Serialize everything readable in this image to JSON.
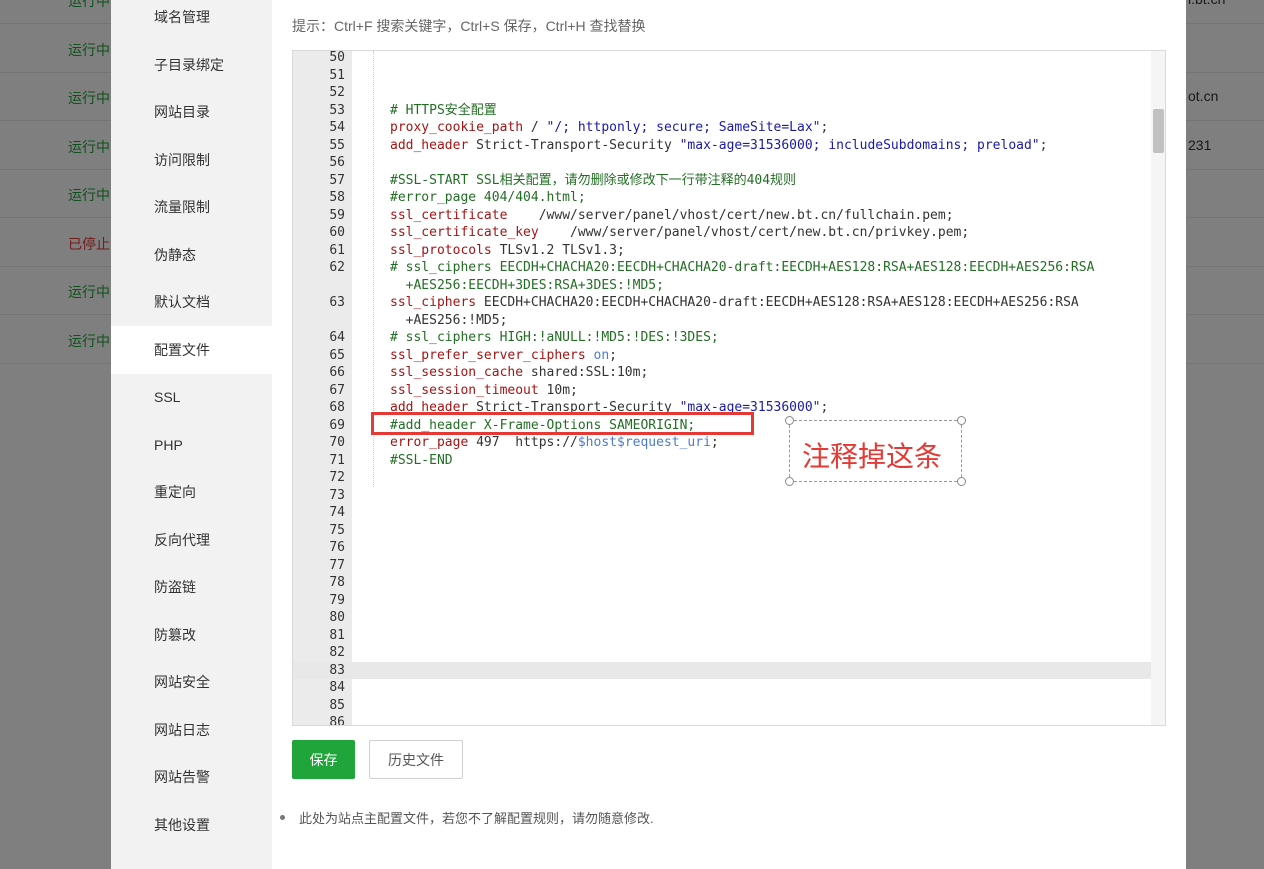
{
  "background": {
    "rows": [
      {
        "status": "运行中",
        "color": "#20a53a",
        "right": "i.bt.cn"
      },
      {
        "status": "运行中",
        "color": "#20a53a",
        "right": ""
      },
      {
        "status": "运行中",
        "color": "#20a53a",
        "right": "ot.cn"
      },
      {
        "status": "运行中",
        "color": "#20a53a",
        "right": "231"
      },
      {
        "status": "运行中",
        "color": "#20a53a",
        "right": ""
      },
      {
        "status": "已停止",
        "color": "#e53935",
        "right": ""
      },
      {
        "status": "运行中",
        "color": "#20a53a",
        "right": ""
      },
      {
        "status": "运行中",
        "color": "#20a53a",
        "right": ""
      }
    ]
  },
  "sidebar": {
    "items": [
      {
        "label": "域名管理"
      },
      {
        "label": "子目录绑定"
      },
      {
        "label": "网站目录"
      },
      {
        "label": "访问限制"
      },
      {
        "label": "流量限制"
      },
      {
        "label": "伪静态"
      },
      {
        "label": "默认文档"
      },
      {
        "label": "配置文件",
        "active": true
      },
      {
        "label": "SSL"
      },
      {
        "label": "PHP"
      },
      {
        "label": "重定向"
      },
      {
        "label": "反向代理"
      },
      {
        "label": "防盗链"
      },
      {
        "label": "防篡改"
      },
      {
        "label": "网站安全"
      },
      {
        "label": "网站日志"
      },
      {
        "label": "网站告警"
      },
      {
        "label": "其他设置"
      }
    ]
  },
  "editor": {
    "hint": "提示：Ctrl+F 搜索关键字，Ctrl+S 保存，Ctrl+H 查找替换",
    "highlight_line": "83",
    "lines": [
      {
        "n": "50",
        "parts": []
      },
      {
        "n": "51",
        "parts": []
      },
      {
        "n": "52",
        "parts": []
      },
      {
        "n": "53",
        "parts": [
          {
            "t": "# HTTPS安全配置",
            "c": "cmt"
          }
        ]
      },
      {
        "n": "54",
        "parts": [
          {
            "t": "proxy_cookie_path",
            "c": "key"
          },
          {
            "t": " / ",
            "c": "plain"
          },
          {
            "t": "\"/; httponly; secure; SameSite=Lax\"",
            "c": "str"
          },
          {
            "t": ";",
            "c": "plain"
          }
        ]
      },
      {
        "n": "55",
        "parts": [
          {
            "t": "add_header",
            "c": "key"
          },
          {
            "t": " Strict-Transport-Security ",
            "c": "plain"
          },
          {
            "t": "\"max-age=31536000; includeSubdomains; preload\"",
            "c": "str"
          },
          {
            "t": ";",
            "c": "plain"
          }
        ]
      },
      {
        "n": "56",
        "parts": []
      },
      {
        "n": "57",
        "parts": [
          {
            "t": "#SSL-START SSL相关配置，请勿删除或修改下一行带注释的404规则",
            "c": "cmt"
          }
        ]
      },
      {
        "n": "58",
        "parts": [
          {
            "t": "#error_page 404/404.html;",
            "c": "cmt"
          }
        ]
      },
      {
        "n": "59",
        "parts": [
          {
            "t": "ssl_certificate",
            "c": "key"
          },
          {
            "t": "    /www/server/panel/vhost/cert/new.bt.cn/fullchain.pem;",
            "c": "plain"
          }
        ]
      },
      {
        "n": "60",
        "parts": [
          {
            "t": "ssl_certificate_key",
            "c": "key"
          },
          {
            "t": "    /www/server/panel/vhost/cert/new.bt.cn/privkey.pem;",
            "c": "plain"
          }
        ]
      },
      {
        "n": "61",
        "parts": [
          {
            "t": "ssl_protocols",
            "c": "key"
          },
          {
            "t": " TLSv1.2 TLSv1.3;",
            "c": "plain"
          }
        ]
      },
      {
        "n": "62",
        "parts": [
          {
            "t": "# ssl_ciphers EECDH+CHACHA20:EECDH+CHACHA20-draft:EECDH+AES128:RSA+AES128:EECDH+AES256:RSA",
            "c": "cmt"
          }
        ]
      },
      {
        "n": "",
        "parts": [
          {
            "t": "  +AES256:EECDH+3DES:RSA+3DES:!MD5;",
            "c": "cmt"
          }
        ]
      },
      {
        "n": "63",
        "parts": [
          {
            "t": "ssl_ciphers",
            "c": "key"
          },
          {
            "t": " EECDH+CHACHA20:EECDH+CHACHA20-draft:EECDH+AES128:RSA+AES128:EECDH+AES256:RSA",
            "c": "plain"
          }
        ]
      },
      {
        "n": "",
        "parts": [
          {
            "t": "  +AES256:!MD5;",
            "c": "plain"
          }
        ]
      },
      {
        "n": "64",
        "parts": [
          {
            "t": "# ssl_ciphers HIGH:!aNULL:!MD5:!DES:!3DES;",
            "c": "cmt"
          }
        ]
      },
      {
        "n": "65",
        "parts": [
          {
            "t": "ssl_prefer_server_ciphers",
            "c": "key"
          },
          {
            "t": " ",
            "c": "plain"
          },
          {
            "t": "on",
            "c": "var"
          },
          {
            "t": ";",
            "c": "plain"
          }
        ]
      },
      {
        "n": "66",
        "parts": [
          {
            "t": "ssl_session_cache",
            "c": "key"
          },
          {
            "t": " shared:SSL:10m;",
            "c": "plain"
          }
        ]
      },
      {
        "n": "67",
        "parts": [
          {
            "t": "ssl_session_timeout",
            "c": "key"
          },
          {
            "t": " 10m;",
            "c": "plain"
          }
        ]
      },
      {
        "n": "68",
        "parts": [
          {
            "t": "add_header",
            "c": "key"
          },
          {
            "t": " Strict-Transport-Security ",
            "c": "plain"
          },
          {
            "t": "\"max-age=31536000\"",
            "c": "str"
          },
          {
            "t": ";",
            "c": "plain"
          }
        ]
      },
      {
        "n": "69",
        "parts": [
          {
            "t": "#add_header X-Frame-Options SAMEORIGIN;",
            "c": "cmt"
          }
        ]
      },
      {
        "n": "70",
        "parts": [
          {
            "t": "error_page",
            "c": "key"
          },
          {
            "t": " 497  https://",
            "c": "plain"
          },
          {
            "t": "$host$request_uri",
            "c": "var"
          },
          {
            "t": ";",
            "c": "plain"
          }
        ]
      },
      {
        "n": "71",
        "parts": [
          {
            "t": "#SSL-END",
            "c": "cmt"
          }
        ]
      },
      {
        "n": "72",
        "parts": []
      },
      {
        "n": "73",
        "parts": []
      },
      {
        "n": "74",
        "parts": []
      },
      {
        "n": "75",
        "parts": []
      },
      {
        "n": "76",
        "parts": []
      },
      {
        "n": "77",
        "parts": []
      },
      {
        "n": "78",
        "parts": []
      },
      {
        "n": "79",
        "parts": []
      },
      {
        "n": "80",
        "parts": []
      },
      {
        "n": "81",
        "parts": []
      },
      {
        "n": "82",
        "parts": []
      },
      {
        "n": "83",
        "parts": []
      },
      {
        "n": "84",
        "parts": []
      },
      {
        "n": "85",
        "parts": []
      },
      {
        "n": "86",
        "parts": []
      }
    ]
  },
  "annotation": {
    "text": "注释掉这条"
  },
  "buttons": {
    "save": "保存",
    "history": "历史文件"
  },
  "note": "此处为站点主配置文件，若您不了解配置规则，请勿随意修改."
}
